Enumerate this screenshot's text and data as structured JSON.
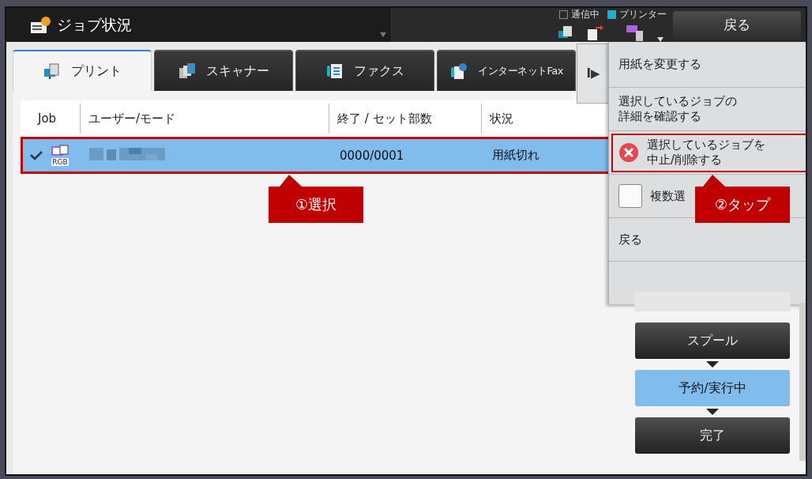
{
  "header": {
    "title": "ジョブ状況",
    "indicators": [
      {
        "label": "通信中",
        "on": false
      },
      {
        "label": "プリンター",
        "on": true
      }
    ],
    "back_button": "戻る"
  },
  "tabs": [
    {
      "label": "プリント",
      "selected": true,
      "kind": "print"
    },
    {
      "label": "スキャナー",
      "selected": false,
      "kind": "scan"
    },
    {
      "label": "ファクス",
      "selected": false,
      "kind": "fax"
    },
    {
      "label": "インターネットFax",
      "selected": false,
      "kind": "ifax"
    }
  ],
  "menu_toggle": "I▶",
  "table": {
    "columns": [
      "Job",
      "ユーザー/モード",
      "終了 / セット部数",
      "状況"
    ],
    "rows": [
      {
        "selected": true,
        "checked": true,
        "badge": "RGB",
        "count": "0000/0001",
        "status": "用紙切れ",
        "outlined": true
      }
    ]
  },
  "menu": {
    "items": [
      {
        "kind": "action",
        "label": "用紙を変更する",
        "outlined": false
      },
      {
        "kind": "action",
        "label": "選択しているジョブの詳細を確認する",
        "outlined": false
      },
      {
        "kind": "cancel",
        "label": "選択しているジョブを中止/削除する",
        "outlined": true
      },
      {
        "kind": "checkbox",
        "label": "複数選",
        "checked": false,
        "outlined": false
      },
      {
        "kind": "action",
        "label": "戻る",
        "outlined": false
      }
    ]
  },
  "stages": [
    {
      "label": "スプール",
      "selected": false
    },
    {
      "label": "予約/実行中",
      "selected": true
    },
    {
      "label": "完了",
      "selected": false
    }
  ],
  "callouts": [
    {
      "label": "①選択",
      "kind": "row"
    },
    {
      "label": "②タップ",
      "kind": "menu"
    }
  ]
}
